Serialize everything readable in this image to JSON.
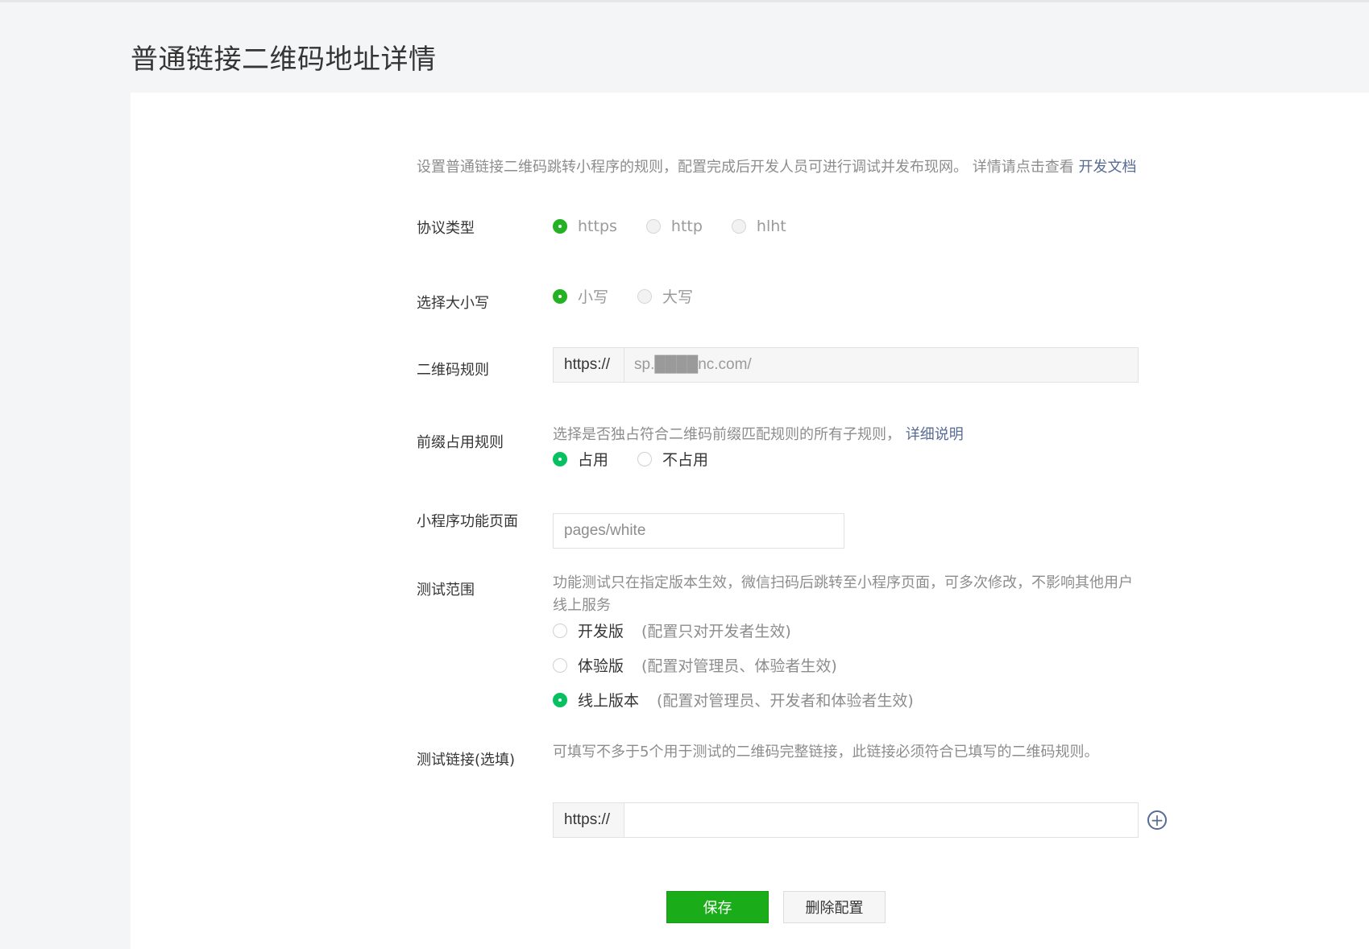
{
  "page": {
    "title": "普通链接二维码地址详情"
  },
  "intro": {
    "text": "设置普通链接二维码跳转小程序的规则，配置完成后开发人员可进行调试并发布现网。 详情请点击查看 ",
    "link": "开发文档"
  },
  "protocol": {
    "label": "协议类型",
    "options": [
      "https",
      "http",
      "hlht"
    ],
    "selected": "https"
  },
  "letter_case": {
    "label": "选择大小写",
    "options": [
      "小写",
      "大写"
    ],
    "selected": "小写"
  },
  "qr_rule": {
    "label": "二维码规则",
    "prefix": "https://",
    "value": "sp.████nc.com/"
  },
  "prefix_rule": {
    "label": "前缀占用规则",
    "hint": "选择是否独占符合二维码前缀匹配规则的所有子规则， ",
    "hint_link": "详细说明",
    "options": [
      "占用",
      "不占用"
    ],
    "selected": "占用"
  },
  "mini_page": {
    "label": "小程序功能页面",
    "value": "pages/white"
  },
  "test_scope": {
    "label": "测试范围",
    "hint": "功能测试只在指定版本生效，微信扫码后跳转至小程序页面，可多次修改，不影响其他用户线上服务",
    "options": [
      {
        "name": "开发版",
        "note": "(配置只对开发者生效)"
      },
      {
        "name": "体验版",
        "note": "(配置对管理员、体验者生效)"
      },
      {
        "name": "线上版本",
        "note": "(配置对管理员、开发者和体验者生效)"
      }
    ],
    "selected": "线上版本"
  },
  "test_link": {
    "label": "测试链接(选填)",
    "hint": "可填写不多于5个用于测试的二维码完整链接，此链接必须符合已填写的二维码规则。",
    "prefix": "https://",
    "value": "",
    "add_icon": "plus-circle-icon"
  },
  "actions": {
    "save": "保存",
    "delete": "删除配置"
  },
  "colors": {
    "primary": "#1aad19",
    "link": "#576b95",
    "background": "#f4f5f6"
  }
}
